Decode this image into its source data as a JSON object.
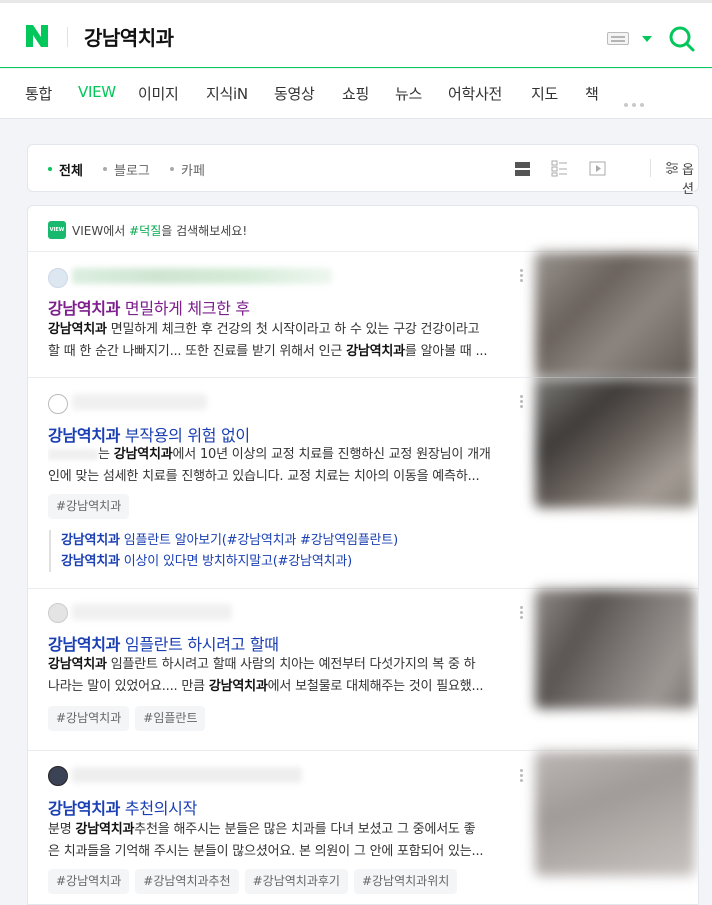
{
  "search": {
    "query": "강남역치과"
  },
  "tabs": [
    {
      "label": "통합"
    },
    {
      "label": "VIEW"
    },
    {
      "label": "이미지"
    },
    {
      "label": "지식iN"
    },
    {
      "label": "동영상"
    },
    {
      "label": "쇼핑"
    },
    {
      "label": "뉴스"
    },
    {
      "label": "어학사전"
    },
    {
      "label": "지도"
    },
    {
      "label": "책"
    }
  ],
  "filter": {
    "tabs": [
      {
        "label": "전체"
      },
      {
        "label": "블로그"
      },
      {
        "label": "카페"
      }
    ],
    "option_label": "옵션"
  },
  "hint": {
    "badge": "VIEW",
    "prefix": "VIEW에서 ",
    "tag": "#덕질",
    "suffix": "을 검색해보세요!"
  },
  "results": [
    {
      "title_keyword": "강남역치과",
      "title_rest": " 면밀하게 체크한 후",
      "desc1_kw": "강남역치과",
      "desc1_rest": " 면밀하게 체크한 후 건강의 첫 시작이라고 하 수 있는 구강 건강이라고",
      "desc2_pre": "할 때 한 순간 나빠지기... 또한 진료를 받기 위해서 인근 ",
      "desc2_kw": "강남역치과",
      "desc2_rest": "를 알아볼 때 ..."
    },
    {
      "title_keyword": "강남역치과",
      "title_rest": " 부작용의 위험 없이",
      "desc1_pre": "는 ",
      "desc1_kw": "강남역치과",
      "desc1_rest": "에서 10년 이상의 교정 치료를 진행하신 교정 원장님이 개개",
      "desc2": "인에 맞는 섬세한 치료를 진행하고 있습니다. 교정 치료는 치아의 이동을 예측하...",
      "tags": [
        "#강남역치과"
      ],
      "related": [
        {
          "kw": "강남역치과",
          "rest": " 임플란트 알아보기(#강남역치과 #강남역임플란트)"
        },
        {
          "kw": "강남역치과",
          "rest": " 이상이 있다면 방치하지말고(#강남역치과)"
        }
      ]
    },
    {
      "title_keyword": "강남역치과",
      "title_rest": " 임플란트 하시려고 할때",
      "desc1_kw": "강남역치과",
      "desc1_rest": " 임플란트 하시려고 할때 사람의 치아는 예전부터 다섯가지의 복 중 하",
      "desc2_pre": "나라는 말이 있었어요.... 만큼 ",
      "desc2_kw": "강남역치과",
      "desc2_rest": "에서 보철물로 대체해주는 것이 필요했...",
      "tags": [
        "#강남역치과",
        "#임플란트"
      ]
    },
    {
      "title_keyword": "강남역치과",
      "title_rest": " 추천의시작",
      "desc1_pre": "분명 ",
      "desc1_kw": "강남역치과",
      "desc1_rest": "추천을 해주시는 분들은 많은 치과를 다녀 보셨고 그 중에서도 좋",
      "desc2": "은 치과들을 기억해 주시는 분들이 많으셨어요. 본 의원이 그 안에 포함되어 있는...",
      "tags": [
        "#강남역치과",
        "#강남역치과추천",
        "#강남역치과후기",
        "#강남역치과위치"
      ]
    }
  ],
  "colors": {
    "brand": "#03c75a",
    "link": "#1a3fb3",
    "visited": "#7c1f8c"
  }
}
